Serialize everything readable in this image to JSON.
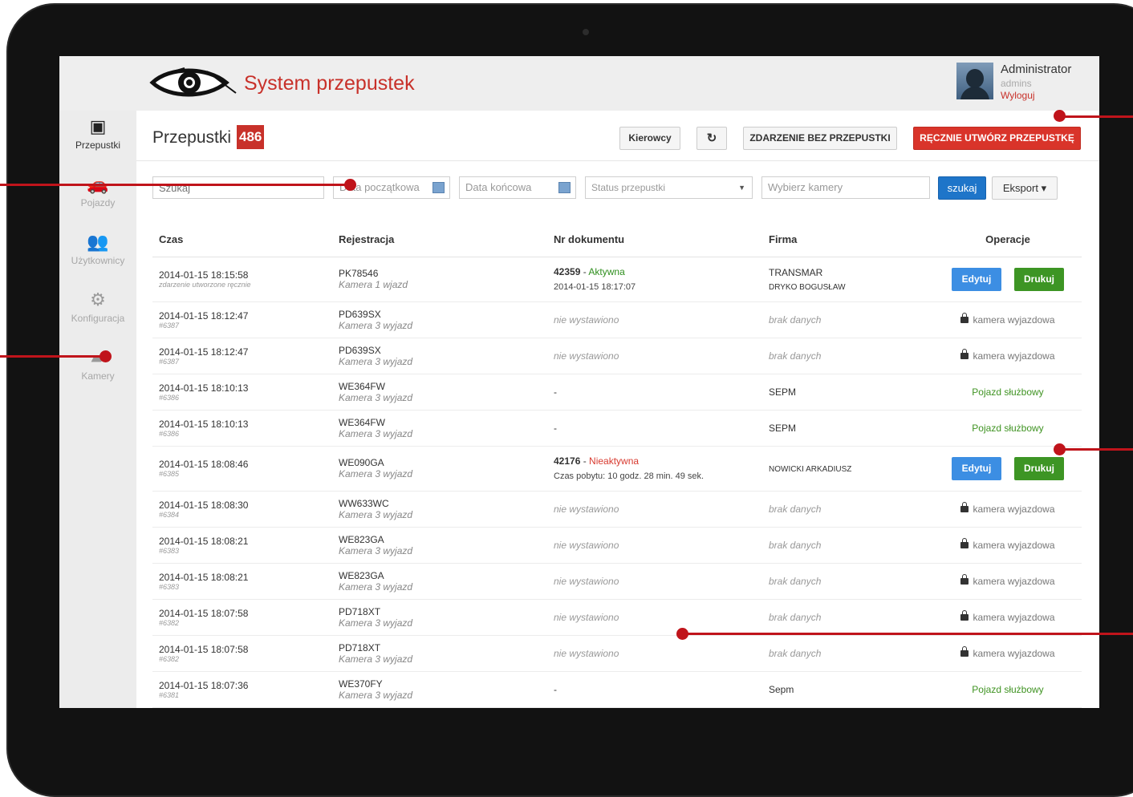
{
  "app": {
    "title": "System przepustek"
  },
  "user": {
    "name": "Administrator",
    "login": "admins",
    "logout_label": "Wyloguj"
  },
  "sidebar": {
    "items": [
      {
        "label": "Przepustki",
        "icon": "id-card-icon",
        "active": true
      },
      {
        "label": "Pojazdy",
        "icon": "car-icon",
        "active": false
      },
      {
        "label": "Użytkownicy",
        "icon": "users-icon",
        "active": false
      },
      {
        "label": "Konfiguracja",
        "icon": "gear-icon",
        "active": false
      },
      {
        "label": "Kamery",
        "icon": "video-camera-icon",
        "active": false
      }
    ]
  },
  "page": {
    "title": "Przepustki",
    "count": "486"
  },
  "toolbar": {
    "drivers_label": "Kierowcy",
    "refresh_icon": "refresh-icon",
    "event_label": "ZDARZENIE BEZ PRZEPUSTKI",
    "create_label": "RĘCZNIE UTWÓRZ PRZEPUSTKĘ"
  },
  "filters": {
    "search_placeholder": "Szukaj",
    "date_from_placeholder": "Data początkowa",
    "date_to_placeholder": "Data końcowa",
    "status_placeholder": "Status przepustki",
    "camera_placeholder": "Wybierz kamery",
    "search_button": "szukaj",
    "export_button": "Eksport"
  },
  "table": {
    "columns": [
      "Czas",
      "Rejestracja",
      "Nr dokumentu",
      "Firma",
      "Operacje"
    ],
    "edit_label": "Edytuj",
    "print_label": "Drukuj",
    "rows": [
      {
        "time": "2014-01-15 18:15:58",
        "sub": "zdarzenie utworzone ręcznie",
        "plate": "PK78546",
        "camera": "Kamera 1 wjazd",
        "doc_no": "42359",
        "doc_status": "Aktywna",
        "doc_extra": "2014-01-15 18:17:07",
        "company": "TRANSMAR",
        "company_sub": "DRYKO BOGUSŁAW",
        "op": "buttons"
      },
      {
        "time": "2014-01-15 18:12:47",
        "sub": "#6387",
        "plate": "PD639SX",
        "camera": "Kamera 3 wyjazd",
        "doc": "nie wystawiono",
        "company": "brak danych",
        "op_text": "kamera wyjazdowa"
      },
      {
        "time": "2014-01-15 18:12:47",
        "sub": "#6387",
        "plate": "PD639SX",
        "camera": "Kamera 3 wyjazd",
        "doc": "nie wystawiono",
        "company": "brak danych",
        "op_text": "kamera wyjazdowa"
      },
      {
        "time": "2014-01-15 18:10:13",
        "sub": "#6386",
        "plate": "WE364FW",
        "camera": "Kamera 3 wyjazd",
        "doc": "-",
        "company": "SEPM",
        "op_green": "Pojazd służbowy"
      },
      {
        "time": "2014-01-15 18:10:13",
        "sub": "#6386",
        "plate": "WE364FW",
        "camera": "Kamera 3 wyjazd",
        "doc": "-",
        "company": "SEPM",
        "op_green": "Pojazd służbowy"
      },
      {
        "time": "2014-01-15 18:08:46",
        "sub": "#6385",
        "plate": "WE090GA",
        "camera": "Kamera 3 wyjazd",
        "doc_no": "42176",
        "doc_status": "Nieaktywna",
        "doc_extra": "Czas pobytu: 10 godz. 28 min. 49 sek.",
        "company": "NOWICKI ARKADIUSZ",
        "op": "buttons"
      },
      {
        "time": "2014-01-15 18:08:30",
        "sub": "#6384",
        "plate": "WW633WC",
        "camera": "Kamera 3 wyjazd",
        "doc": "nie wystawiono",
        "company": "brak danych",
        "op_text": "kamera wyjazdowa"
      },
      {
        "time": "2014-01-15 18:08:21",
        "sub": "#6383",
        "plate": "WE823GA",
        "camera": "Kamera 3 wyjazd",
        "doc": "nie wystawiono",
        "company": "brak danych",
        "op_text": "kamera wyjazdowa"
      },
      {
        "time": "2014-01-15 18:08:21",
        "sub": "#6383",
        "plate": "WE823GA",
        "camera": "Kamera 3 wyjazd",
        "doc": "nie wystawiono",
        "company": "brak danych",
        "op_text": "kamera wyjazdowa"
      },
      {
        "time": "2014-01-15 18:07:58",
        "sub": "#6382",
        "plate": "PD718XT",
        "camera": "Kamera 3 wyjazd",
        "doc": "nie wystawiono",
        "company": "brak danych",
        "op_text": "kamera wyjazdowa"
      },
      {
        "time": "2014-01-15 18:07:58",
        "sub": "#6382",
        "plate": "PD718XT",
        "camera": "Kamera 3 wyjazd",
        "doc": "nie wystawiono",
        "company": "brak danych",
        "op_text": "kamera wyjazdowa"
      },
      {
        "time": "2014-01-15 18:07:36",
        "sub": "#6381",
        "plate": "WE370FY",
        "camera": "Kamera 3 wyjazd",
        "doc": "-",
        "company": "Sepm",
        "op_green": "Pojazd służbowy"
      }
    ]
  },
  "colors": {
    "accent": "#c8312a",
    "primary": "#1e75c9",
    "success": "#3d9524",
    "callout": "#c0141b"
  }
}
